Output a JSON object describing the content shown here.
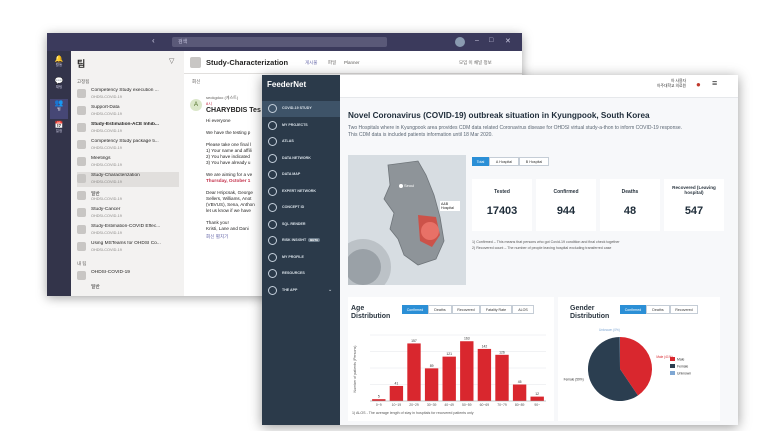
{
  "teams": {
    "search_placeholder": "검색",
    "rail": [
      {
        "icon": "bell-icon",
        "label": "활동"
      },
      {
        "icon": "chat-icon",
        "label": "채팅"
      },
      {
        "icon": "teams-icon",
        "label": "팀"
      },
      {
        "icon": "calendar-icon",
        "label": "일정"
      }
    ],
    "list_header": "팀",
    "group_label": "고정됨",
    "channels": [
      {
        "title": "Competency Study execution ...",
        "sub": "OHDSI-COVID-19",
        "bold": false,
        "selected": false
      },
      {
        "title": "Support-Data",
        "sub": "OHDSI-COVID-19",
        "bold": false,
        "selected": false
      },
      {
        "title": "Study-Estimation-ACE Inhib...",
        "sub": "OHDSI-COVID-19",
        "bold": true,
        "selected": false
      },
      {
        "title": "Competency Study package ti...",
        "sub": "OHDSI-COVID-19",
        "bold": false,
        "selected": false
      },
      {
        "title": "Meetings",
        "sub": "OHDSI-COVID-19",
        "bold": false,
        "selected": false
      },
      {
        "title": "Study-Characterization",
        "sub": "OHDSI-COVID-19",
        "bold": false,
        "selected": true
      },
      {
        "title": "일반",
        "sub": "OHDSI-COVID-19",
        "bold": false,
        "selected": false
      },
      {
        "title": "Study-Cancer",
        "sub": "OHDSI-COVID-19",
        "bold": false,
        "selected": false
      },
      {
        "title": "Study-Estimation-COVID Effec...",
        "sub": "OHDSI-COVID-19",
        "bold": false,
        "selected": false
      },
      {
        "title": "Using MSTeams for OHDSI Co...",
        "sub": "OHDSI-COVID-19",
        "bold": false,
        "selected": false
      }
    ],
    "group2_label": "내 팀",
    "team_item": "OHDSI-COVID-19",
    "team_item2": "일반",
    "channel_title": "Study-Characterization",
    "tabs": [
      "게시물",
      "파일",
      "Planner"
    ],
    "header_actions": "모임   이 채널 정보",
    "message_author": "seokgdoo (게스트)",
    "message_time": "8시",
    "message_subject": "CHARYBDIS Tes",
    "message_lines": [
      "Hi everyone",
      "",
      "We have the testing p",
      "",
      "Please take one final l",
      "1) Your name and affili",
      "2) You have indicated",
      "3) You have already u",
      "",
      "We are aiming for a ve",
      "Thursday, October 1",
      "",
      "Dear Hripcsak, George",
      "Sellers, Williams, Anot",
      "(VBVUS), Sena, Anthon",
      "let us know if we have",
      "",
      "Thank you!",
      "Kristi, Lane and Dani"
    ],
    "reply_label": "회신",
    "expand_label": "회신 펼치기"
  },
  "feedernet": {
    "brand": "FeederNet",
    "nav": [
      "COVID-19 STUDY",
      "MY PROJECTS",
      "ATLAS",
      "DATA NETWORK",
      "DATA MAP",
      "EXPERT NETWORK",
      "CONCEPT ID",
      "SQL RENDER",
      "RISK INSIGHT",
      "MY PROFILE",
      "RESOURCES",
      "THE APP"
    ],
    "nav_beta_label": "BETA",
    "user_label": "아 사용자",
    "user_sub": "아주대학교 의료원",
    "title": "Novel Coronavirus (COVID-19) outbreak situation in Kyungpook, South Korea",
    "desc_lines": [
      "Two Hospitals where in Kyungpook area provides CDM data related Coronavirus disease for OHDSI virtual study-a-thon to inform COVID-19 response.",
      "This CDM data is included patients information until 18 Mar 2020."
    ],
    "map_labels": {
      "seoul": "Seoul",
      "hospital": "A&B Hospital"
    },
    "filter_buttons": [
      "Total",
      "A Hospital",
      "B Hospital"
    ],
    "stats": [
      {
        "label": "Tested",
        "value": "17403"
      },
      {
        "label": "Confirmed",
        "value": "944"
      },
      {
        "label": "Deaths",
        "value": "48"
      },
      {
        "label": "Recovered (Leaving hospital)",
        "value": "547"
      }
    ],
    "stats_notes": [
      "1) Confirmed – This means that persons who got Covid-19 condition and final check together",
      "2) Recovered count – The number of people leaving hospital excluding transferred case"
    ],
    "age": {
      "title": "Age Distribution",
      "buttons": [
        "Confirmed",
        "Deaths",
        "Recovered",
        "Fatality Rate",
        "ALOS"
      ],
      "note": "1) ALOS - The average length of stay in hospitals for recovered patients only"
    },
    "gender": {
      "title": "Gender Distribution",
      "buttons": [
        "Confirmed",
        "Deaths",
        "Recovered"
      ]
    }
  },
  "chart_data": [
    {
      "type": "bar",
      "title": "Age Distribution",
      "categories": [
        "0~9",
        "10~19",
        "20~29",
        "30~39",
        "40~49",
        "50~59",
        "60~69",
        "70~79",
        "80~89",
        "90~"
      ],
      "values": [
        5,
        41,
        157,
        89,
        121,
        163,
        142,
        126,
        45,
        12
      ],
      "data_labels": [
        "5",
        "41",
        "157",
        "89",
        "121",
        "163",
        "142",
        "126",
        "45",
        "12"
      ],
      "ylabel": "Number of patients (Persons)",
      "ylim": [
        0,
        180
      ],
      "grid": true,
      "color": "#d9272e"
    },
    {
      "type": "pie",
      "title": "Gender Distribution",
      "categories": [
        "Male",
        "Female",
        "Unknown"
      ],
      "values": [
        383,
        561,
        1
      ],
      "slice_labels": [
        "Male (41%)",
        "Female (59%)",
        "Unknown (0%)"
      ],
      "colors": [
        "#d9272e",
        "#2b3e50",
        "#7fa7d3"
      ],
      "legend": "right"
    }
  ]
}
